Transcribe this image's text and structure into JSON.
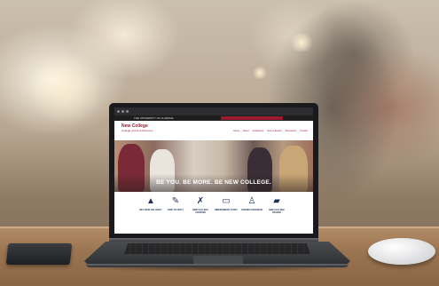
{
  "site": {
    "university": "THE UNIVERSITY OF ALABAMA",
    "college_title": "New College",
    "college_subtitle": "College of Arts & Sciences",
    "nav": [
      "Home",
      "About",
      "Academics",
      "New & Events",
      "Resources",
      "Contact"
    ],
    "tagline": "BE YOU. BE MORE. BE NEW COLLEGE.",
    "icons": [
      {
        "label": "WHY NEW COLLEGE?",
        "icon": "mountain-icon"
      },
      {
        "label": "HOW TO APPLY",
        "icon": "form-icon"
      },
      {
        "label": "NEW COLLEGE COURSES",
        "icon": "figure-icon"
      },
      {
        "label": "INDEPENDENT STUDY",
        "icon": "monitor-icon"
      },
      {
        "label": "SCIENCE PROGRAM",
        "icon": "person-icon"
      },
      {
        "label": "NEW COLLEGE REVIEW",
        "icon": "book-icon"
      }
    ]
  },
  "colors": {
    "brand": "#9b1b30",
    "icon": "#1f2f5a"
  }
}
